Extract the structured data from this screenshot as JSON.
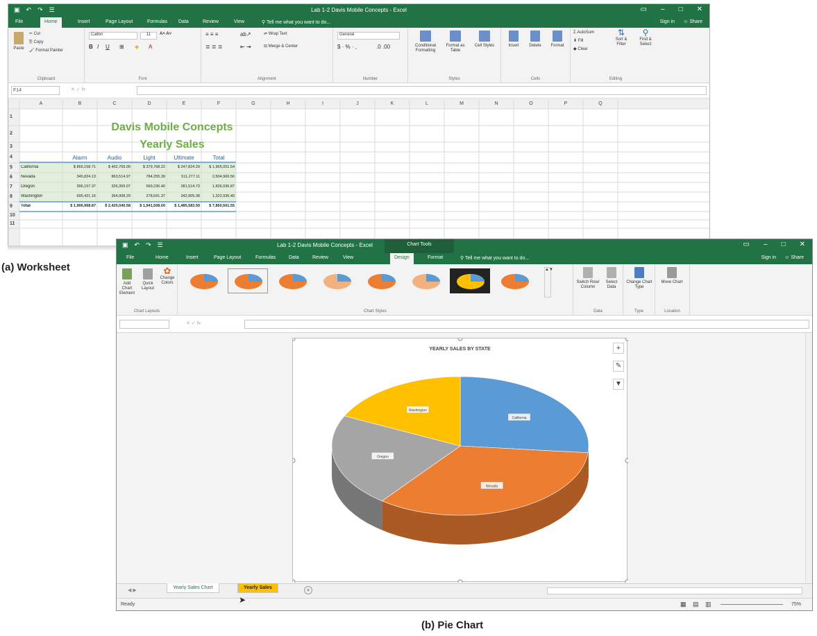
{
  "caption_a": "(a) Worksheet",
  "caption_b": "(b) Pie Chart",
  "worksheet": {
    "title": "Lab 1-2 Davis Mobile Concepts - Excel",
    "signin": "Sign in",
    "share": "Share",
    "tell": "Tell me what you want to do...",
    "tabs": [
      "File",
      "Home",
      "Insert",
      "Page Layout",
      "Formulas",
      "Data",
      "Review",
      "View"
    ],
    "clipboard": {
      "cut": "Cut",
      "copy": "Copy",
      "paste": "Paste",
      "painter": "Format Painter",
      "label": "Clipboard"
    },
    "font": {
      "name": "Calibri",
      "size": "11",
      "label": "Font"
    },
    "alignment": {
      "wrap": "Wrap Text",
      "merge": "Merge & Center",
      "label": "Alignment"
    },
    "number": {
      "format": "General",
      "label": "Number"
    },
    "styles": {
      "cond": "Conditional Formatting",
      "table": "Format as Table",
      "cell": "Cell Styles",
      "label": "Styles"
    },
    "cells": {
      "insert": "Insert",
      "delete": "Delete",
      "format": "Format",
      "label": "Cells"
    },
    "editing": {
      "autosum": "AutoSum",
      "fill": "Fill",
      "clear": "Clear",
      "sort": "Sort & Filter",
      "find": "Find & Select",
      "label": "Editing"
    },
    "namebox": "F14",
    "columns": [
      "A",
      "B",
      "C",
      "D",
      "E",
      "F",
      "G",
      "H",
      "I",
      "J",
      "K",
      "L",
      "M",
      "N",
      "O",
      "P",
      "Q"
    ],
    "rows": [
      "1",
      "2",
      "3",
      "4",
      "5",
      "6",
      "7",
      "8",
      "9",
      "10",
      "11"
    ],
    "heading1": "Davis Mobile Concepts",
    "heading2": "Yearly Sales",
    "headers": [
      "Alarm",
      "Audio",
      "Light",
      "Ultimate",
      "Total"
    ],
    "data_rows": [
      {
        "label": "California",
        "cells": [
          "$ 866,158.71",
          "$ 402,759.09",
          "$ 379,768.22",
          "$ 247,824.29",
          "$ 1,965,051.54"
        ]
      },
      {
        "label": "Nevada",
        "cells": [
          "345,824.13",
          "863,514.97",
          "784,255.39",
          "511,277.11",
          "2,504,969.56"
        ]
      },
      {
        "label": "Oregon",
        "cells": [
          "396,157.37",
          "326,359.07",
          "569,235.40",
          "381,514.73",
          "1,606,036.87"
        ]
      },
      {
        "label": "Washington",
        "cells": [
          "695,421.16",
          "364,908.29",
          "278,691.37",
          "342,905.38",
          "1,322,936.40"
        ]
      },
      {
        "label": "Total",
        "cells": [
          "$ 1,906,968.87",
          "$ 2,420,040.58",
          "$ 1,941,508.00",
          "$ 1,485,583.50",
          "$ 7,850,501.55"
        ]
      }
    ]
  },
  "chartwin": {
    "title": "Lab 1-2 Davis Mobile Concepts - Excel",
    "context_tab": "Chart Tools",
    "signin": "Sign in",
    "share": "Share",
    "tell": "Tell me what you want to do...",
    "tabs": [
      "File",
      "Home",
      "Insert",
      "Page Layout",
      "Formulas",
      "Data",
      "Review",
      "View",
      "Design",
      "Format"
    ],
    "add_chart": "Add Chart Element",
    "quick_layout": "Quick Layout",
    "change_colors": "Change Colors",
    "layouts_label": "Chart Layouts",
    "styles_label": "Chart Styles",
    "switch": "Switch Row/ Column",
    "select_data": "Select Data",
    "data_label": "Data",
    "change_type": "Change Chart Type",
    "type_label": "Type",
    "move_chart": "Move Chart",
    "location_label": "Location",
    "chart_title": "YEARLY SALES BY STATE",
    "sheet_tabs": [
      "Yearly Sales Chart",
      "Yearly Sales"
    ],
    "status": "Ready",
    "zoom": "75%"
  },
  "chart_data": {
    "type": "pie",
    "title": "YEARLY SALES BY STATE",
    "categories": [
      "California",
      "Nevada",
      "Oregon",
      "Washington"
    ],
    "values": [
      1965051.54,
      2504969.56,
      1606036.87,
      1322936.4
    ],
    "colors": [
      "#5b9bd5",
      "#ed7d31",
      "#a5a5a5",
      "#ffc000"
    ],
    "labels": [
      "California",
      "Nevada",
      "Oregon",
      "Washington"
    ]
  }
}
